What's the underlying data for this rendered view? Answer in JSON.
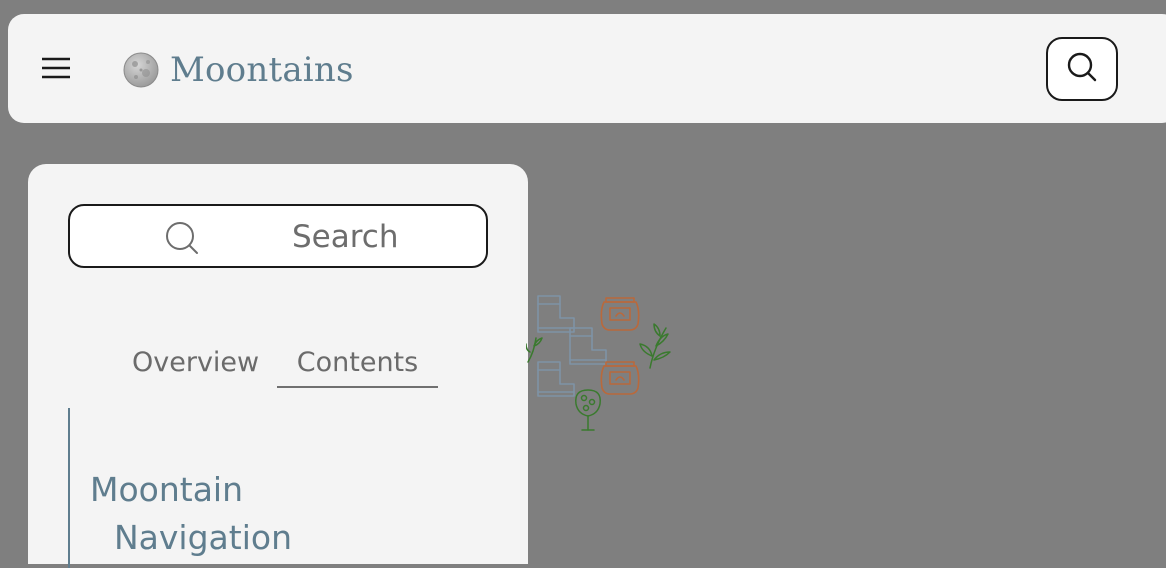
{
  "header": {
    "menu_icon": "hamburger-menu-icon",
    "logo_icon": "moon-logo-icon",
    "brand_name": "Moontains",
    "search_icon": "search-icon"
  },
  "sidebar": {
    "search": {
      "icon": "search-icon",
      "label": "Search"
    },
    "tabs": [
      {
        "label": "Overview",
        "active": false
      },
      {
        "label": "Contents",
        "active": true
      }
    ],
    "toc": {
      "items": [
        {
          "label_line1": "Moontain",
          "label_line2": "Navigation"
        }
      ]
    }
  },
  "illustration": {
    "icon": "garden-boots-seed-bags-doodle",
    "colors": {
      "boots": "#7f93a6",
      "bags": "#b9693c",
      "plants": "#3a7a2e"
    }
  },
  "theme": {
    "page_bg": "#7f7f7f",
    "panel_bg": "#f4f4f4",
    "accent": "#5f7d8e",
    "muted_text": "#6b6b6b"
  }
}
